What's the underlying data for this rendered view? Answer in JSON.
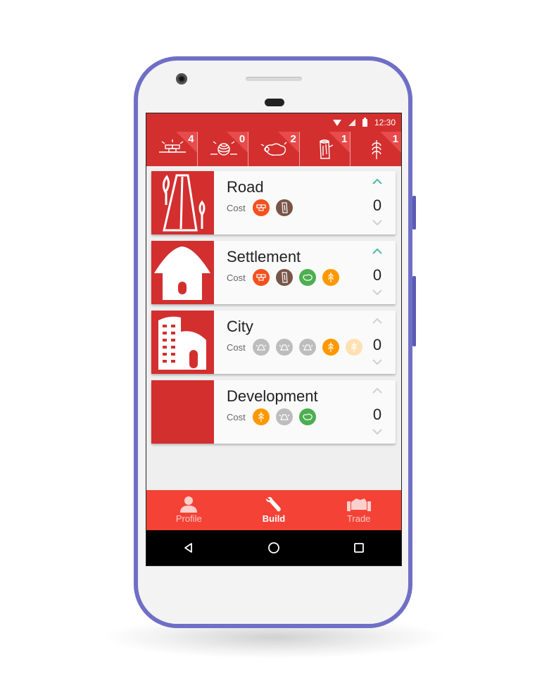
{
  "status_bar": {
    "time": "12:30",
    "icons": [
      "wifi-icon",
      "signal-icon",
      "battery-icon"
    ]
  },
  "resources": [
    {
      "name": "brick",
      "icon": "brick-icon",
      "count": "4"
    },
    {
      "name": "wool",
      "icon": "wool-icon",
      "count": "0"
    },
    {
      "name": "sheep",
      "icon": "sheep-icon",
      "count": "2"
    },
    {
      "name": "lumber",
      "icon": "lumber-icon",
      "count": "1"
    },
    {
      "name": "grain",
      "icon": "grain-icon",
      "count": "1"
    }
  ],
  "build_items": [
    {
      "title": "Road",
      "cost_label": "Cost",
      "quantity": "0",
      "icon": "road-icon",
      "cost": [
        {
          "resource": "brick",
          "color": "#f4511e",
          "available": true
        },
        {
          "resource": "lumber",
          "color": "#795548",
          "available": true
        }
      ],
      "can_increase": true
    },
    {
      "title": "Settlement",
      "cost_label": "Cost",
      "quantity": "0",
      "icon": "house-icon",
      "cost": [
        {
          "resource": "brick",
          "color": "#f4511e",
          "available": true
        },
        {
          "resource": "lumber",
          "color": "#795548",
          "available": true
        },
        {
          "resource": "sheep",
          "color": "#4caf50",
          "available": true
        },
        {
          "resource": "grain",
          "color": "#ff9800",
          "available": true
        }
      ],
      "can_increase": true
    },
    {
      "title": "City",
      "cost_label": "Cost",
      "quantity": "0",
      "icon": "city-icon",
      "cost": [
        {
          "resource": "ore",
          "color": "#bdbdbd",
          "available": false
        },
        {
          "resource": "ore",
          "color": "#bdbdbd",
          "available": false
        },
        {
          "resource": "ore",
          "color": "#bdbdbd",
          "available": false
        },
        {
          "resource": "grain",
          "color": "#ff9800",
          "available": true
        },
        {
          "resource": "grain",
          "color": "#ffe0b2",
          "available": false
        }
      ],
      "can_increase": false
    },
    {
      "title": "Development",
      "cost_label": "Cost",
      "quantity": "0",
      "icon": "",
      "cost": [
        {
          "resource": "grain",
          "color": "#ff9800",
          "available": true
        },
        {
          "resource": "ore",
          "color": "#bdbdbd",
          "available": false
        },
        {
          "resource": "sheep",
          "color": "#4caf50",
          "available": true
        }
      ],
      "can_increase": false
    }
  ],
  "bottom_nav": [
    {
      "label": "Profile",
      "icon": "person-icon",
      "active": false
    },
    {
      "label": "Build",
      "icon": "wrench-icon",
      "active": true
    },
    {
      "label": "Trade",
      "icon": "handshake-icon",
      "active": false
    }
  ],
  "system_nav": [
    "back-icon",
    "home-icon",
    "recents-icon"
  ],
  "colors": {
    "primary": "#d32f2f",
    "nav": "#f44336",
    "chevron_active": "#4db6ac",
    "chevron_inactive": "#cfcfcf"
  }
}
